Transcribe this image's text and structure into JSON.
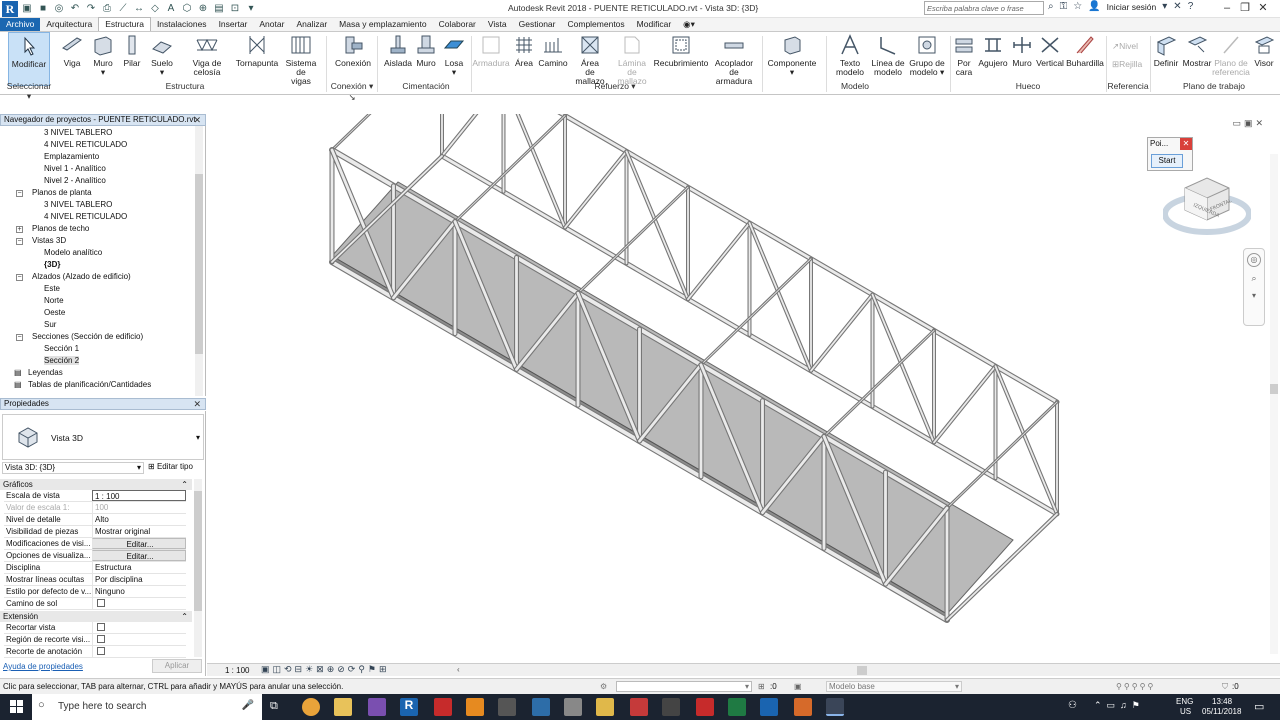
{
  "titlebar": {
    "app_title": "Autodesk Revit 2018 -     PUENTE RETICULADO.rvt - Vista 3D: {3D}",
    "logo_letter": "R",
    "search_placeholder": "Escriba palabra clave o frase",
    "signin": "Iniciar sesión"
  },
  "tabs": [
    {
      "label": "Archivo"
    },
    {
      "label": "Arquitectura"
    },
    {
      "label": "Estructura"
    },
    {
      "label": "Instalaciones"
    },
    {
      "label": "Insertar"
    },
    {
      "label": "Anotar"
    },
    {
      "label": "Analizar"
    },
    {
      "label": "Masa y emplazamiento"
    },
    {
      "label": "Colaborar"
    },
    {
      "label": "Vista"
    },
    {
      "label": "Gestionar"
    },
    {
      "label": "Complementos"
    },
    {
      "label": "Modificar"
    }
  ],
  "active_tab": "Estructura",
  "ribbon": {
    "buttons": [
      {
        "label": "Modificar",
        "label2": ""
      },
      {
        "label": "Viga",
        "label2": ""
      },
      {
        "label": "Muro",
        "label2": "▾"
      },
      {
        "label": "Pilar",
        "label2": ""
      },
      {
        "label": "Suelo",
        "label2": "▾"
      },
      {
        "label": "Viga de celosía",
        "label2": ""
      },
      {
        "label": "Tornapunta",
        "label2": ""
      },
      {
        "label": "Sistema de",
        "label2": "vigas"
      },
      {
        "label": "Conexión",
        "label2": ""
      },
      {
        "label": "Aislada",
        "label2": ""
      },
      {
        "label": "Muro",
        "label2": ""
      },
      {
        "label": "Losa",
        "label2": "▾"
      },
      {
        "label": "Armadura",
        "label2": ""
      },
      {
        "label": "Área",
        "label2": ""
      },
      {
        "label": "Camino",
        "label2": ""
      },
      {
        "label": "Área",
        "label2": "de mallazo"
      },
      {
        "label": "Lámina",
        "label2": "de mallazo"
      },
      {
        "label": "Recubrimiento",
        "label2": ""
      },
      {
        "label": "Acoplador",
        "label2": "de armadura"
      },
      {
        "label": "Componente",
        "label2": "▾"
      },
      {
        "label": "Texto",
        "label2": "modelo"
      },
      {
        "label": "Línea de",
        "label2": "modelo"
      },
      {
        "label": "Grupo de",
        "label2": "modelo ▾"
      },
      {
        "label": "Por",
        "label2": "cara"
      },
      {
        "label": "Agujero",
        "label2": ""
      },
      {
        "label": "Muro",
        "label2": ""
      },
      {
        "label": "Vertical",
        "label2": ""
      },
      {
        "label": "Buhardilla",
        "label2": ""
      },
      {
        "label": "Nivel",
        "label2": ""
      },
      {
        "label": "Rejilla",
        "label2": ""
      },
      {
        "label": "Definir",
        "label2": ""
      },
      {
        "label": "Mostrar",
        "label2": ""
      },
      {
        "label": "Plano de",
        "label2": "referencia"
      },
      {
        "label": "Visor",
        "label2": ""
      }
    ],
    "groups": [
      {
        "label": "Seleccionar ▾"
      },
      {
        "label": "Estructura"
      },
      {
        "label": "Conexión ▾ ↘"
      },
      {
        "label": "Cimentación"
      },
      {
        "label": "Refuerzo ▾"
      },
      {
        "label": "Modelo"
      },
      {
        "label": "Hueco"
      },
      {
        "label": "Referencia"
      },
      {
        "label": "Plano de trabajo"
      }
    ]
  },
  "project_browser": {
    "title": "Navegador de proyectos - PUENTE RETICULADO.rvt",
    "items": [
      {
        "label": "3 NIVEL TABLERO",
        "expander": ""
      },
      {
        "label": "4 NIVEL RETICULADO",
        "expander": ""
      },
      {
        "label": "Emplazamiento",
        "expander": ""
      },
      {
        "label": "Nivel 1 - Analítico",
        "expander": ""
      },
      {
        "label": "Nivel 2 - Analítico",
        "expander": ""
      },
      {
        "label": "Planos de planta",
        "expander": "−"
      },
      {
        "label": "3 NIVEL TABLERO",
        "expander": ""
      },
      {
        "label": "4 NIVEL RETICULADO",
        "expander": ""
      },
      {
        "label": "Planos de techo",
        "expander": "+"
      },
      {
        "label": "Vistas 3D",
        "expander": "−"
      },
      {
        "label": "Modelo analítico",
        "expander": ""
      },
      {
        "label": "{3D}",
        "expander": ""
      },
      {
        "label": "Alzados (Alzado de edificio)",
        "expander": "−"
      },
      {
        "label": "Este",
        "expander": ""
      },
      {
        "label": "Norte",
        "expander": ""
      },
      {
        "label": "Oeste",
        "expander": ""
      },
      {
        "label": "Sur",
        "expander": ""
      },
      {
        "label": "Secciones (Sección de edificio)",
        "expander": "−"
      },
      {
        "label": "Sección 1",
        "expander": ""
      },
      {
        "label": "Sección 2",
        "expander": ""
      },
      {
        "label": "Leyendas",
        "expander": ""
      },
      {
        "label": "Tablas de planificación/Cantidades",
        "expander": ""
      }
    ]
  },
  "properties": {
    "title": "Propiedades",
    "type_name": "Vista 3D",
    "selector": "Vista 3D: {3D}",
    "edit_type": "Editar tipo",
    "sections": [
      {
        "label": "Gráficos"
      },
      {
        "label": "Extensión"
      }
    ],
    "rows": [
      {
        "key": "Escala de vista",
        "value": "1 : 100",
        "kind": "input"
      },
      {
        "key": "Valor de escala    1:",
        "value": "100",
        "kind": "disabled"
      },
      {
        "key": "Nivel de detalle",
        "value": "Alto",
        "kind": "text"
      },
      {
        "key": "Visibilidad de piezas",
        "value": "Mostrar original",
        "kind": "text"
      },
      {
        "key": "Modificaciones de visi...",
        "value": "Editar...",
        "kind": "button"
      },
      {
        "key": "Opciones de visualiza...",
        "value": "Editar...",
        "kind": "button"
      },
      {
        "key": "Disciplina",
        "value": "Estructura",
        "kind": "text"
      },
      {
        "key": "Mostrar líneas ocultas",
        "value": "Por disciplina",
        "kind": "text"
      },
      {
        "key": "Estilo por defecto de v...",
        "value": "Ninguno",
        "kind": "text"
      },
      {
        "key": "Camino de sol",
        "value": "",
        "kind": "checkbox"
      },
      {
        "key": "Recortar vista",
        "value": "",
        "kind": "checkbox"
      },
      {
        "key": "Región de recorte visi...",
        "value": "",
        "kind": "checkbox"
      },
      {
        "key": "Recorte de anotación",
        "value": "",
        "kind": "checkbox"
      }
    ],
    "help_link": "Ayuda de propiedades",
    "apply": "Aplicar"
  },
  "viewport": {
    "popup_title": "Poi...",
    "popup_button": "Start",
    "viewcube_faces": [
      "IZQUIERDA",
      "FRONTAL"
    ]
  },
  "view_bar": {
    "scale": "1 : 100"
  },
  "status_bar": {
    "message": "Clic para seleccionar, TAB para alternar, CTRL para añadir y MAYÚS para anular una selección.",
    "coord": ":0",
    "model": "Modelo base",
    "filter_count": ":0"
  },
  "taskbar": {
    "search_placeholder": "Type here to search",
    "lang": "ENG",
    "lang2": "US",
    "time": "13:48",
    "date": "05/11/2018"
  }
}
